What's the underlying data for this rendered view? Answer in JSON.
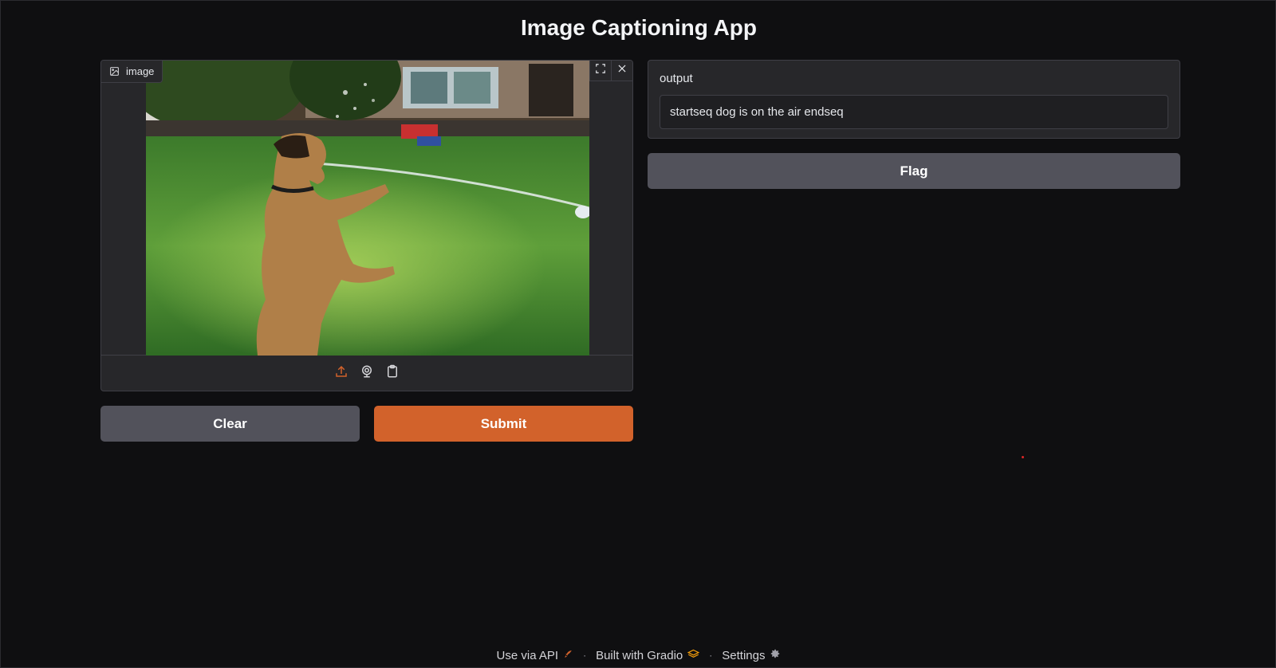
{
  "app_title": "Image Captioning App",
  "image_input": {
    "label": "image",
    "label_icon": "image-icon",
    "tools": [
      "fullscreen-icon",
      "close-icon"
    ],
    "sources": [
      "upload-icon",
      "webcam-icon",
      "clipboard-icon"
    ]
  },
  "buttons": {
    "clear": "Clear",
    "submit": "Submit",
    "flag": "Flag"
  },
  "output": {
    "label": "output",
    "value": "startseq dog is on the air endseq"
  },
  "footer": {
    "api": "Use via API",
    "built": "Built with Gradio",
    "settings": "Settings",
    "separator": "·"
  },
  "colors": {
    "background": "#0f0f11",
    "panel": "#27272a",
    "primary": "#d2622b",
    "secondary": "#52525b"
  }
}
